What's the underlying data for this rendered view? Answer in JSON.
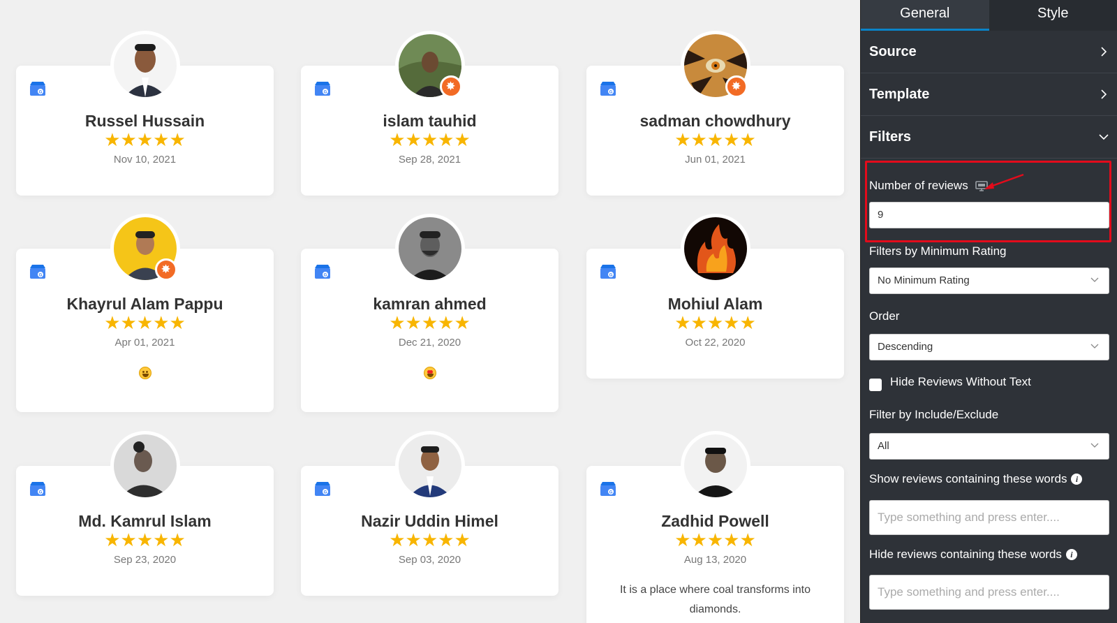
{
  "reviews": [
    {
      "name": "Russel Hussain",
      "date": "Nov 10, 2021",
      "stars": "★★★★★",
      "rating": 5
    },
    {
      "name": "islam tauhid",
      "date": "Sep 28, 2021",
      "stars": "★★★★★",
      "rating": 5
    },
    {
      "name": "sadman chowdhury",
      "date": "Jun 01, 2021",
      "stars": "★★★★★",
      "rating": 5
    },
    {
      "name": "Khayrul Alam Pappu",
      "date": "Apr 01, 2021",
      "stars": "★★★★★",
      "rating": 5
    },
    {
      "name": "kamran ahmed",
      "date": "Dec 21, 2020",
      "stars": "★★★★★",
      "rating": 5
    },
    {
      "name": "Mohiul Alam",
      "date": "Oct 22, 2020",
      "stars": "★★★★★",
      "rating": 5
    },
    {
      "name": "Md. Kamrul Islam",
      "date": "Sep 23, 2020",
      "stars": "★★★★★",
      "rating": 5
    },
    {
      "name": "Nazir Uddin Himel",
      "date": "Sep 03, 2020",
      "stars": "★★★★★",
      "rating": 5
    },
    {
      "name": "Zadhid Powell",
      "date": "Aug 13, 2020",
      "stars": "★★★★★",
      "rating": 5,
      "text": "It is a place where coal transforms into diamonds."
    }
  ],
  "panel": {
    "tabs": [
      "General",
      "Style"
    ],
    "sections": {
      "source": "Source",
      "template": "Template",
      "filters": "Filters"
    },
    "number_of_reviews": {
      "label": "Number of reviews",
      "value": "9"
    },
    "min_rating": {
      "label": "Filters by Minimum Rating",
      "value": "No Minimum Rating"
    },
    "order": {
      "label": "Order",
      "value": "Descending"
    },
    "hide_without_text": {
      "label": "Hide Reviews Without Text",
      "checked": false
    },
    "include_exclude": {
      "label": "Filter by Include/Exclude",
      "value": "All"
    },
    "show_words": {
      "label": "Show reviews containing these words",
      "placeholder": "Type something and press enter...."
    },
    "hide_words": {
      "label": "Hide reviews containing these words",
      "placeholder": "Type something and press enter...."
    }
  },
  "colors": {
    "star": "#f8b500",
    "panel_bg": "#2e3238",
    "highlight": "#e30b1b",
    "accent": "#0a84c8",
    "badge": "#f26b25"
  }
}
